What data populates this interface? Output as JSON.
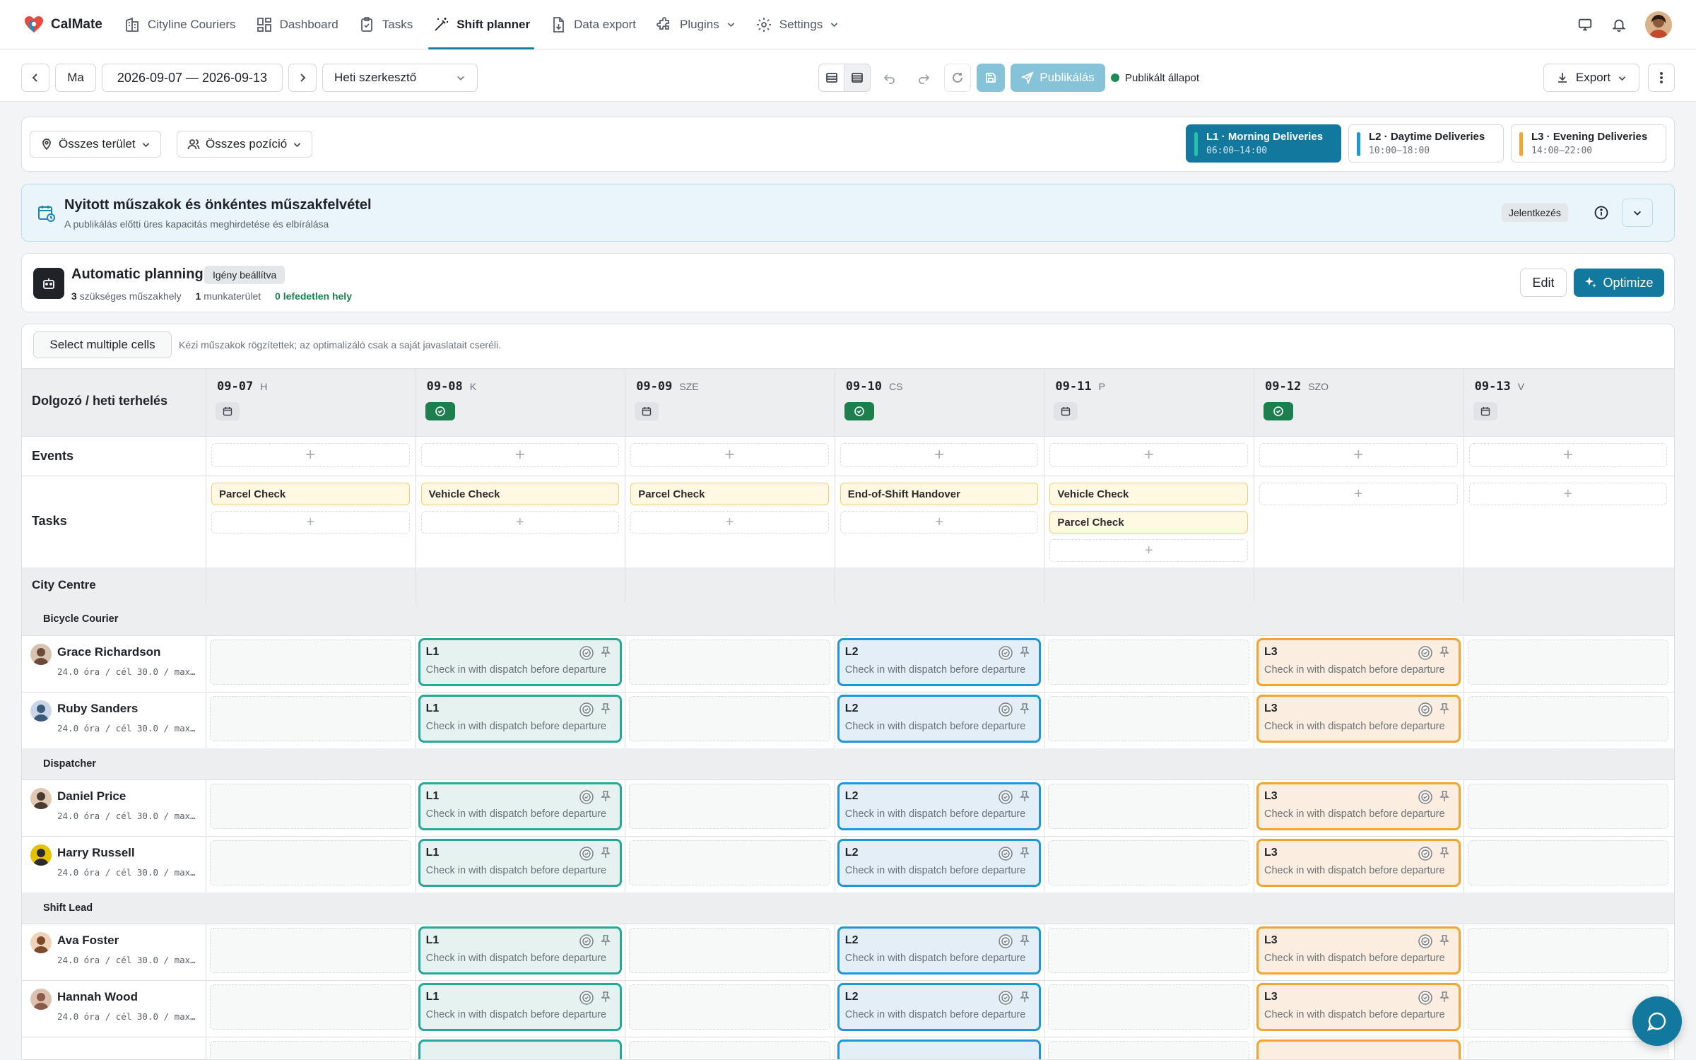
{
  "brand": {
    "name": "CalMate"
  },
  "nav": [
    {
      "label": "Cityline Couriers",
      "icon": "building-icon"
    },
    {
      "label": "Dashboard",
      "icon": "dashboard-icon"
    },
    {
      "label": "Tasks",
      "icon": "clipboard-icon"
    },
    {
      "label": "Shift planner",
      "icon": "magic-wand-icon",
      "active": true
    },
    {
      "label": "Data export",
      "icon": "file-download-icon"
    },
    {
      "label": "Plugins",
      "icon": "puzzle-icon",
      "dropdown": true
    },
    {
      "label": "Settings",
      "icon": "gear-icon",
      "dropdown": true
    }
  ],
  "toolbar": {
    "today": "Ma",
    "date_range": "2026-09-07 — 2026-09-13",
    "view_select": "Heti szerkesztő",
    "publish": "Publikálás",
    "status": "Publikált állapot",
    "export": "Export"
  },
  "filters": {
    "area": "Összes terület",
    "position": "Összes pozíció"
  },
  "shift_types": [
    {
      "code": "L1",
      "name": "L1 · Morning Deliveries",
      "time": "06:00–14:00",
      "color": "#27a797"
    },
    {
      "code": "L2",
      "name": "L2 · Daytime Deliveries",
      "time": "10:00–18:00",
      "color": "#1d97d6"
    },
    {
      "code": "L3",
      "name": "L3 · Evening Deliveries",
      "time": "14:00–22:00",
      "color": "#f0a431"
    }
  ],
  "open_shifts": {
    "title": "Nyitott műszakok és önkéntes műszakfelvétel",
    "subtitle": "A publikálás előtti üres kapacitás meghirdetése és elbírálása",
    "badge": "Jelentkezés"
  },
  "auto": {
    "title": "Automatic planning",
    "badge": "Igény beállítva",
    "stat1_num": "3",
    "stat1_label": "szükséges műszakhely",
    "stat2_num": "1",
    "stat2_label": "munkaterület",
    "stat3": "0 lefedetlen hely",
    "edit": "Edit",
    "optimize": "Optimize"
  },
  "select": {
    "button": "Select multiple cells",
    "hint": "Kézi műszakok rögzítettek; az optimalizáló csak a saját javaslatait cseréli."
  },
  "grid": {
    "corner": "Dolgozó / heti terhelés",
    "days": [
      {
        "date": "09-07",
        "wd": "H",
        "badge": "cal"
      },
      {
        "date": "09-08",
        "wd": "K",
        "badge": "ok"
      },
      {
        "date": "09-09",
        "wd": "SZE",
        "badge": "cal"
      },
      {
        "date": "09-10",
        "wd": "CS",
        "badge": "ok"
      },
      {
        "date": "09-11",
        "wd": "P",
        "badge": "cal"
      },
      {
        "date": "09-12",
        "wd": "SZO",
        "badge": "ok"
      },
      {
        "date": "09-13",
        "wd": "V",
        "badge": "cal"
      }
    ],
    "events_label": "Events",
    "tasks_label": "Tasks",
    "tasks": [
      [
        "Parcel Check"
      ],
      [
        "Vehicle Check"
      ],
      [
        "Parcel Check"
      ],
      [
        "End-of-Shift Handover"
      ],
      [
        "Vehicle Check",
        "Parcel Check"
      ],
      [],
      []
    ],
    "area": "City Centre",
    "shift_desc": "Check in with dispatch before departure",
    "groups": [
      {
        "name": "Bicycle Courier",
        "people": [
          {
            "name": "Grace Richardson",
            "meta": "24.0 óra / cél 30.0 / max…"
          },
          {
            "name": "Ruby Sanders",
            "meta": "24.0 óra / cél 30.0 / max…"
          }
        ]
      },
      {
        "name": "Dispatcher",
        "people": [
          {
            "name": "Daniel Price",
            "meta": "24.0 óra / cél 30.0 / max…"
          },
          {
            "name": "Harry Russell",
            "meta": "24.0 óra / cél 30.0 / max…"
          }
        ]
      },
      {
        "name": "Shift Lead",
        "people": [
          {
            "name": "Ava Foster",
            "meta": "24.0 óra / cél 30.0 / max…"
          },
          {
            "name": "Hannah Wood",
            "meta": "24.0 óra / cél 30.0 / max…"
          }
        ]
      }
    ],
    "pattern": [
      "",
      "L1",
      "",
      "L2",
      "",
      "L3",
      ""
    ]
  }
}
